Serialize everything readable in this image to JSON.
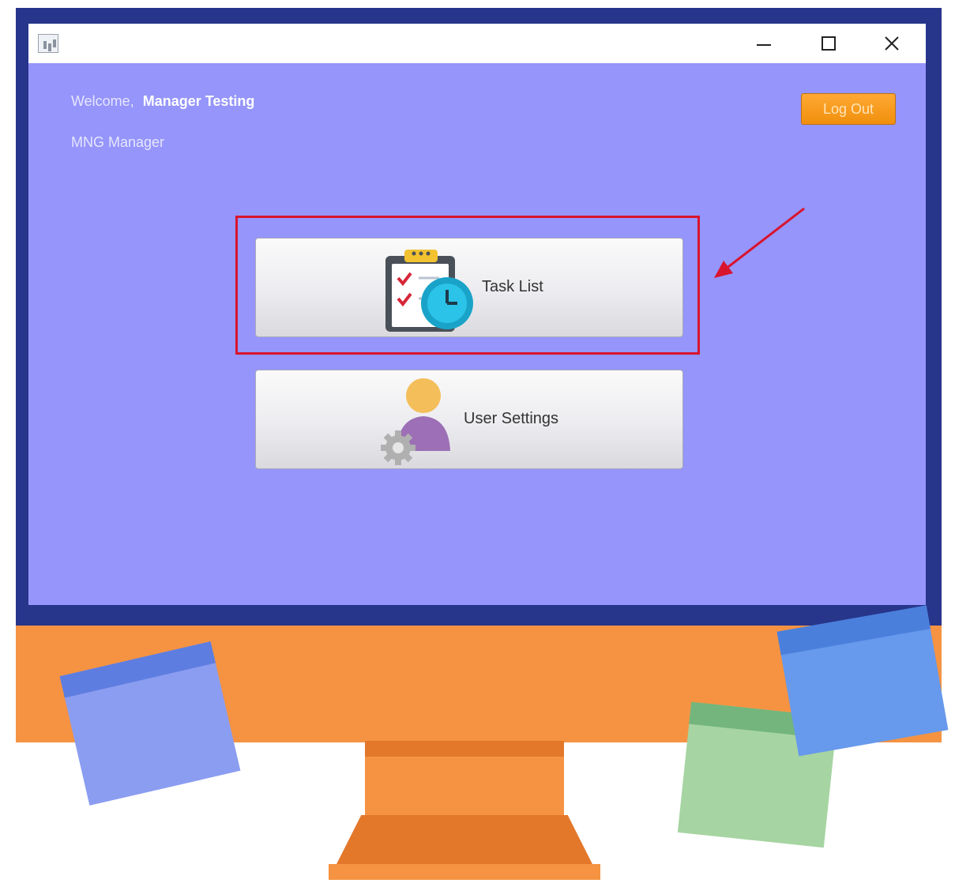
{
  "window": {
    "app_icon": "chart-icon",
    "controls": {
      "minimize_icon": "minimize-icon",
      "maximize_icon": "maximize-icon",
      "close_icon": "close-icon"
    }
  },
  "header": {
    "welcome_prefix": "Welcome,",
    "user_name": "Manager Testing",
    "role": "MNG Manager",
    "logout_label": "Log Out"
  },
  "main": {
    "task_list": {
      "label": "Task List",
      "icon": "clipboard-clock-icon"
    },
    "user_settings": {
      "label": "User Settings",
      "icon": "user-gear-icon"
    }
  },
  "colors": {
    "window_background": "#9595fb",
    "bezel": "#27358b",
    "monitor_orange": "#f59342",
    "logout_orange": "#f7980f",
    "highlight_red": "#d9142e"
  }
}
